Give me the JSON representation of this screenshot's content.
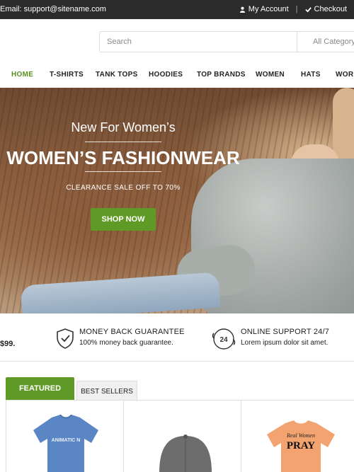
{
  "topbar": {
    "email": "Email: support@sitename.com",
    "my_account": "My Account",
    "separator": "|",
    "checkout": "Checkout"
  },
  "search": {
    "placeholder": "Search",
    "category": "All Category"
  },
  "nav": {
    "items": [
      "HOME",
      "T-SHIRTS",
      "TANK TOPS",
      "HOODIES",
      "TOP BRANDS",
      "WOMEN",
      "HATS",
      "WORK"
    ],
    "active": "HOME"
  },
  "hero": {
    "subtitle": "New For Women’s",
    "title": "WOMEN’S FASHIONWEAR",
    "sale": "CLEARANCE SALE OFF TO 70%",
    "button": "SHOP NOW"
  },
  "features": {
    "partial": "$99.",
    "items": [
      {
        "icon": "shield-check-icon",
        "title": "MONEY BACK GUARANTEE",
        "desc": "100% money back guarantee."
      },
      {
        "icon": "support-24-icon",
        "title": "ONLINE SUPPORT 24/7",
        "desc": "Lorem ipsum dolor sit amet."
      }
    ]
  },
  "tabs": {
    "featured": "FEATURED",
    "best_sellers": "BEST SELLERS"
  },
  "products": {
    "items": [
      {
        "image": "blue-tshirt",
        "print": "ANIMATIC N"
      },
      {
        "image": "gray-cap",
        "print": ""
      },
      {
        "image": "orange-tshirt",
        "print_line1": "Real Women",
        "print_line2": "PRAY"
      }
    ]
  },
  "colors": {
    "accent": "#5f9a26",
    "topbar": "#2b2b2b"
  }
}
